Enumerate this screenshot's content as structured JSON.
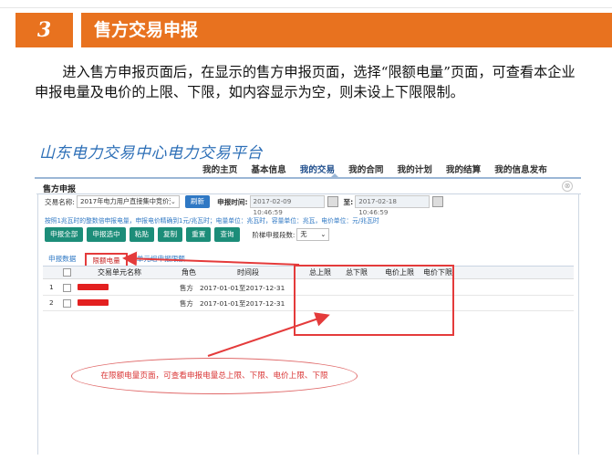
{
  "slide": {
    "number": "3",
    "title": "售方交易申报",
    "paragraph": "进入售方申报页面后，在显示的售方申报页面，选择“限额电量”页面，可查看本企业申报电量及电价的上限、下限，如内容显示为空，则未设上下限限制。"
  },
  "app": {
    "brand": "山东电力交易中心电力交易平台",
    "nav": [
      "我的主页",
      "基本信息",
      "我的交易",
      "我的合同",
      "我的计划",
      "我的结算",
      "我的信息发布"
    ],
    "nav_active_index": 2
  },
  "panel": {
    "title": "售方申报",
    "close_glyph": "⊗",
    "trade_label": "交易名称:",
    "trade_value": "2017年电力用户直接集中竞价交易",
    "refresh": "刷新",
    "time_label": "申报时间:",
    "time_start": "2017-02-09 10:46:59",
    "to_label": "至:",
    "time_end": "2017-02-18 10:46:59",
    "hint": "按照1兆瓦时的整数倍申报电量，申报电价精确到1元/兆瓦时；电量单位：兆瓦时，容量单位：兆瓦，电价单位：元/兆瓦时",
    "buttons": [
      "申报全部",
      "申报选中",
      "粘贴",
      "复制",
      "重置",
      "查询"
    ],
    "segment_label": "阶梯申报段数:",
    "segment_value": "无"
  },
  "tabs": [
    "申报数据",
    "限额电量",
    "单元组申报限额"
  ],
  "active_tab_index": 1,
  "table": {
    "headers": [
      "交易单元名称",
      "角色",
      "时间段",
      "总上限",
      "总下限",
      "电价上限",
      "电价下限"
    ],
    "rows": [
      {
        "index": "1",
        "name": "",
        "role": "售方",
        "period": "2017-01-01至2017-12-31",
        "total_max": "",
        "total_min": "",
        "price_max": "",
        "price_min": ""
      },
      {
        "index": "2",
        "name": "",
        "role": "售方",
        "period": "2017-01-01至2017-12-31",
        "total_max": "",
        "total_min": "",
        "price_max": "",
        "price_min": ""
      }
    ]
  },
  "annotation": "在限额电量页面，可查看申报电量总上限、下限、电价上限、下限",
  "colors": {
    "accent_orange": "#e8721f",
    "brand_blue": "#2d6fb7",
    "button_green": "#1c8d79",
    "button_blue": "#2f78c4",
    "highlight_red": "#e43b3b"
  }
}
